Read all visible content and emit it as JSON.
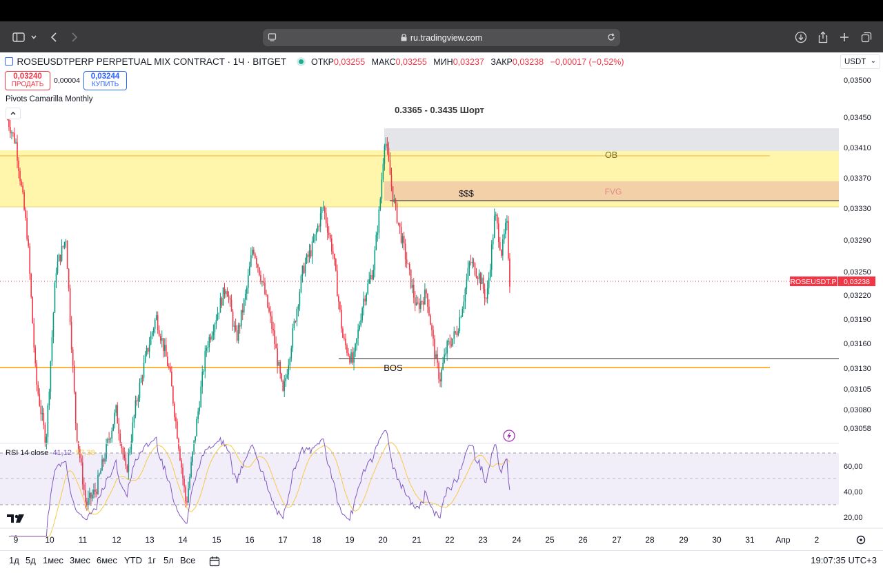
{
  "browser": {
    "url": "ru.tradingview.com"
  },
  "header": {
    "symbol_line": "ROSEUSDTPERP PERPETUAL MIX CONTRACT · 1Ч · BITGET",
    "open_label": "ОТКР",
    "open_value": "0,03255",
    "high_label": "МАКС",
    "high_value": "0,03255",
    "low_label": "МИН",
    "low_value": "0,03237",
    "close_label": "ЗАКР",
    "close_value": "0,03238",
    "change": "−0,00017 (−0,52%)",
    "currency": "USDT"
  },
  "trade": {
    "sell_price": "0,03240",
    "sell_label": "ПРОДАТЬ",
    "spread": "0,00004",
    "buy_price": "0,03244",
    "buy_label": "КУПИТЬ"
  },
  "indicator_label": "Pivots Camarilla Monthly",
  "annotations": {
    "short_zone": "0.3365 - 0.3435 Шорт",
    "ob": "OB",
    "fvg": "FVG",
    "liquidity": "$$$",
    "bos": "BOS"
  },
  "price_axis": {
    "ticks": [
      "0,03500",
      "0,03450",
      "0,03410",
      "0,03370",
      "0,03330",
      "0,03290",
      "0,03250",
      "0,03220",
      "0,03190",
      "0,03160",
      "0,03130",
      "0,03105",
      "0,03080",
      "0,03058"
    ],
    "last_symbol": "ROSEUSDT.P",
    "last_price": "0,03238"
  },
  "rsi": {
    "label": "RSI 14 close",
    "value": "41,12",
    "ma_value": "57,38",
    "ticks": [
      "60,00",
      "40,00",
      "20,00"
    ]
  },
  "time_axis": {
    "ticks": [
      "9",
      "10",
      "11",
      "12",
      "13",
      "14",
      "15",
      "16",
      "17",
      "18",
      "19",
      "20",
      "21",
      "22",
      "23",
      "24",
      "25",
      "26",
      "27",
      "28",
      "29",
      "30",
      "31",
      "Апр",
      "2"
    ]
  },
  "bottom": {
    "ranges": [
      "1д",
      "5д",
      "1мес",
      "3мес",
      "6мес",
      "YTD",
      "1г",
      "5л",
      "Все"
    ],
    "clock": "19:07:35 UTC+3"
  },
  "colors": {
    "up": "#089981",
    "down": "#f23645",
    "rsi": "#7e57c2",
    "rsi_ma": "#f7c948",
    "zone_yellow": "#fff59d",
    "pivot_orange": "#ff9800"
  },
  "chart_data": {
    "type": "candlestick",
    "timeframe": "1h",
    "x_range": [
      "9",
      "2"
    ],
    "y_range": [
      0.0305,
      0.0351
    ],
    "last_price": 0.03238,
    "ohlc_last": {
      "open": 0.03255,
      "high": 0.03255,
      "low": 0.03237,
      "close": 0.03238
    },
    "path": [
      [
        8.75,
        0.0345
      ],
      [
        9.0,
        0.0342
      ],
      [
        9.35,
        0.033
      ],
      [
        9.6,
        0.0312
      ],
      [
        9.9,
        0.0304
      ],
      [
        10.2,
        0.0326
      ],
      [
        10.5,
        0.033
      ],
      [
        10.8,
        0.0306
      ],
      [
        11.1,
        0.0296
      ],
      [
        11.4,
        0.0298
      ],
      [
        11.7,
        0.0303
      ],
      [
        12.0,
        0.0308
      ],
      [
        12.3,
        0.03
      ],
      [
        12.6,
        0.0309
      ],
      [
        12.9,
        0.0315
      ],
      [
        13.2,
        0.032
      ],
      [
        13.6,
        0.0313
      ],
      [
        13.9,
        0.0303
      ],
      [
        14.1,
        0.0296
      ],
      [
        14.4,
        0.0306
      ],
      [
        14.7,
        0.0316
      ],
      [
        15.0,
        0.032
      ],
      [
        15.3,
        0.0324
      ],
      [
        15.6,
        0.0317
      ],
      [
        15.9,
        0.0323
      ],
      [
        16.1,
        0.0329
      ],
      [
        16.4,
        0.0324
      ],
      [
        16.7,
        0.0318
      ],
      [
        17.0,
        0.031
      ],
      [
        17.3,
        0.0318
      ],
      [
        17.6,
        0.0326
      ],
      [
        17.9,
        0.0329
      ],
      [
        18.2,
        0.0334
      ],
      [
        18.5,
        0.0328
      ],
      [
        18.8,
        0.0317
      ],
      [
        19.1,
        0.0314
      ],
      [
        19.4,
        0.0322
      ],
      [
        19.7,
        0.0326
      ],
      [
        19.9,
        0.0334
      ],
      [
        20.05,
        0.0343
      ],
      [
        20.3,
        0.0335
      ],
      [
        20.5,
        0.0331
      ],
      [
        20.75,
        0.0326
      ],
      [
        21.0,
        0.0321
      ],
      [
        21.3,
        0.0323
      ],
      [
        21.55,
        0.0315
      ],
      [
        21.7,
        0.0312
      ],
      [
        21.9,
        0.0316
      ],
      [
        22.2,
        0.0318
      ],
      [
        22.4,
        0.0322
      ],
      [
        22.6,
        0.0327
      ],
      [
        22.9,
        0.0325
      ],
      [
        23.1,
        0.0322
      ],
      [
        23.35,
        0.0333
      ],
      [
        23.55,
        0.0328
      ],
      [
        23.7,
        0.0332
      ],
      [
        23.8,
        0.03238
      ]
    ]
  }
}
